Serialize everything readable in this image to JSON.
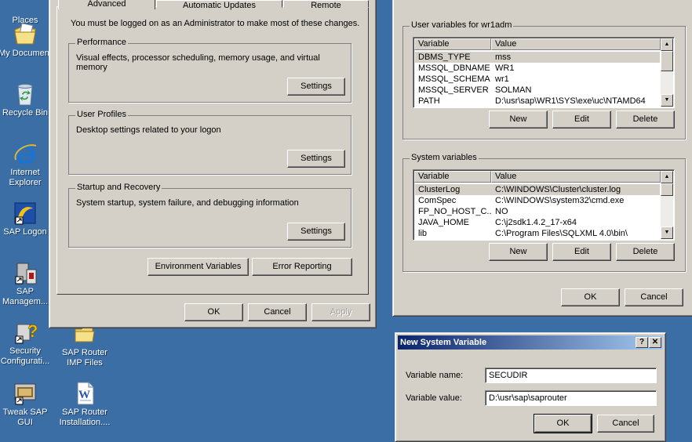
{
  "desktop": {
    "icons": [
      {
        "label": "Places",
        "icon": "network-places-icon"
      },
      {
        "label": "My Document",
        "icon": "my-documents-icon"
      },
      {
        "label": "Recycle Bin",
        "icon": "recycle-bin-icon"
      },
      {
        "label": "Internet",
        "label2": "Explorer",
        "icon": "internet-explorer-icon"
      },
      {
        "label": "SAP Logon",
        "icon": "sap-logon-icon"
      },
      {
        "label": "SAP",
        "label2": "Managem...",
        "icon": "sap-management-icon"
      },
      {
        "label": "Security",
        "label2": "Configurati...",
        "icon": "security-config-icon"
      },
      {
        "label": "SAP Router",
        "label2": "IMP Files",
        "icon": "folder-icon"
      },
      {
        "label": "Tweak SAP",
        "label2": "GUI",
        "icon": "tweak-sap-gui-icon"
      },
      {
        "label": "SAP Router",
        "label2": "Installation....",
        "icon": "word-document-icon"
      }
    ]
  },
  "system_properties": {
    "tabs": [
      "Advanced",
      "Automatic Updates",
      "Remote"
    ],
    "admin_note": "You must be logged on as an Administrator to make most of these changes.",
    "performance": {
      "title": "Performance",
      "desc": "Visual effects, processor scheduling, memory usage, and virtual memory",
      "button": "Settings"
    },
    "user_profiles": {
      "title": "User Profiles",
      "desc": "Desktop settings related to your logon",
      "button": "Settings"
    },
    "startup": {
      "title": "Startup and Recovery",
      "desc": "System startup, system failure, and debugging information",
      "button": "Settings"
    },
    "env_button": "Environment Variables",
    "error_button": "Error Reporting",
    "ok": "OK",
    "cancel": "Cancel",
    "apply": "Apply"
  },
  "env_vars": {
    "user_title": "User variables for wr1adm",
    "col_variable": "Variable",
    "col_value": "Value",
    "user_rows": [
      {
        "name": "DBMS_TYPE",
        "value": "mss"
      },
      {
        "name": "MSSQL_DBNAME",
        "value": "WR1"
      },
      {
        "name": "MSSQL_SCHEMA",
        "value": "wr1"
      },
      {
        "name": "MSSQL_SERVER",
        "value": "SOLMAN"
      },
      {
        "name": "PATH",
        "value": "D:\\usr\\sap\\WR1\\SYS\\exe\\uc\\NTAMD64"
      }
    ],
    "system_title": "System variables",
    "system_rows": [
      {
        "name": "ClusterLog",
        "value": "C:\\WINDOWS\\Cluster\\cluster.log"
      },
      {
        "name": "ComSpec",
        "value": "C:\\WINDOWS\\system32\\cmd.exe"
      },
      {
        "name": "FP_NO_HOST_C...",
        "value": "NO"
      },
      {
        "name": "JAVA_HOME",
        "value": "C:\\j2sdk1.4.2_17-x64"
      },
      {
        "name": "lib",
        "value": "C:\\Program Files\\SQLXML 4.0\\bin\\"
      }
    ],
    "new": "New",
    "edit": "Edit",
    "delete": "Delete",
    "ok": "OK",
    "cancel": "Cancel"
  },
  "new_var_dialog": {
    "title": "New System Variable",
    "help": "?",
    "close": "✕",
    "name_label": "Variable name:",
    "name_value": "SECUDIR",
    "value_label": "Variable value:",
    "value_value": "D:\\usr\\sap\\saprouter",
    "ok": "OK",
    "cancel": "Cancel"
  },
  "colors": {
    "desktop": "#3a6ea5",
    "dialog": "#d4d0c8",
    "titlebar_start": "#0a246a",
    "titlebar_end": "#a6caf0"
  }
}
